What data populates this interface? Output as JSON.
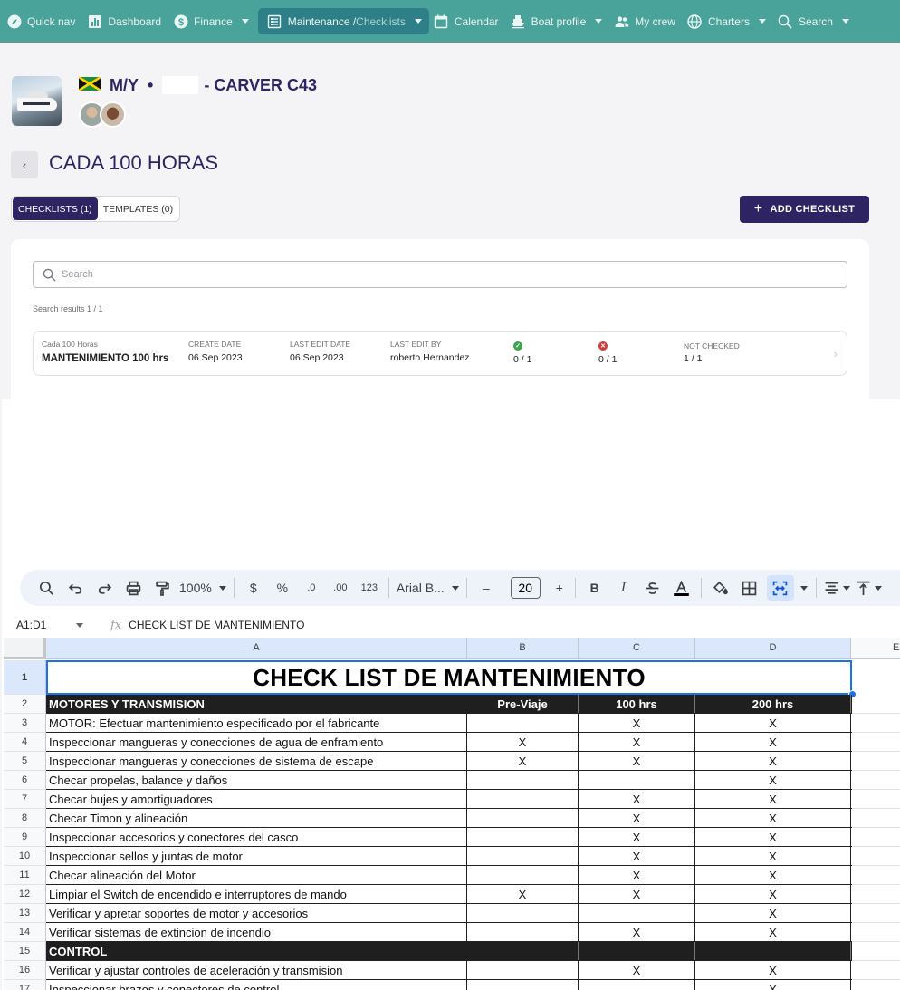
{
  "nav": {
    "items": [
      {
        "label": "Quick nav",
        "icon": "compass-icon"
      },
      {
        "label": "Dashboard",
        "icon": "bar-chart-icon"
      },
      {
        "label": "Finance",
        "icon": "dollar-icon"
      },
      {
        "label": "Maintenance / ",
        "label_dim": "Checklists",
        "icon": "checklist-icon"
      },
      {
        "label": "Calendar",
        "icon": "calendar-icon"
      },
      {
        "label": "Boat profile",
        "icon": "boat-icon"
      },
      {
        "label": "My crew",
        "icon": "people-icon"
      },
      {
        "label": "Charters",
        "icon": "globe-icon"
      },
      {
        "label": "Search",
        "icon": "search-icon"
      }
    ]
  },
  "boat": {
    "prefix": "M/Y",
    "separator": "•",
    "model": "- CARVER C43"
  },
  "page": {
    "back": "‹",
    "title": "CADA 100 HORAS"
  },
  "tabs": [
    {
      "label": "CHECKLISTS (1)",
      "active": true
    },
    {
      "label": "TEMPLATES (0)",
      "active": false
    }
  ],
  "add_button": {
    "icon": "+",
    "label": "ADD CHECKLIST"
  },
  "search": {
    "placeholder": "Search",
    "results": "Search results 1 / 1"
  },
  "checklist_card": {
    "category": "Cada 100 Horas",
    "name": "MANTENIMIENTO 100 hrs",
    "create_label": "CREATE DATE",
    "create_date": "06 Sep 2023",
    "edit_label": "LAST EDIT DATE",
    "edit_date": "06 Sep 2023",
    "editor_label": "LAST EDIT BY",
    "editor": "roberto Hernandez",
    "ok_count": "0 / 1",
    "fail_count": "0 / 1",
    "not_checked_label": "NOT CHECKED",
    "not_checked": "1 / 1"
  },
  "sheet": {
    "zoom": "100%",
    "currency": "$",
    "percent": "%",
    "dec_less": ".0",
    "dec_more": ".00",
    "number_format": "123",
    "font": "Arial B...",
    "font_size": "20",
    "minus": "–",
    "plus": "+",
    "bold": "B",
    "italic": "I",
    "name_box": "A1:D1",
    "fx": "fx",
    "formula": "CHECK LIST DE MANTENIMIENTO",
    "columns": [
      "A",
      "B",
      "C",
      "D",
      "E"
    ],
    "title": "CHECK LIST DE MANTENIMIENTO",
    "rows": [
      {
        "n": "2",
        "a": "MOTORES Y TRANSMISION",
        "b": "Pre-Viaje",
        "c": "100 hrs",
        "d": "200 hrs",
        "dark": true
      },
      {
        "n": "3",
        "a": "MOTOR: Efectuar mantenimiento especificado por el fabricante",
        "b": "",
        "c": "X",
        "d": "X"
      },
      {
        "n": "4",
        "a": "Inspeccionar mangueras y conecciones de agua de enframiento",
        "b": "X",
        "c": "X",
        "d": "X"
      },
      {
        "n": "5",
        "a": "Inspeccionar mangueras y conecciones de sistema de escape",
        "b": "X",
        "c": "X",
        "d": "X"
      },
      {
        "n": "6",
        "a": "Checar propelas, balance y daños",
        "b": "",
        "c": "",
        "d": "X"
      },
      {
        "n": "7",
        "a": "Checar bujes y amortiguadores",
        "b": "",
        "c": "X",
        "d": "X"
      },
      {
        "n": "8",
        "a": "Checar Timon y alineación",
        "b": "",
        "c": "X",
        "d": "X"
      },
      {
        "n": "9",
        "a": "Inspeccionar accesorios y conectores del casco",
        "b": "",
        "c": "X",
        "d": "X"
      },
      {
        "n": "10",
        "a": "Inspeccionar sellos y juntas de motor",
        "b": "",
        "c": "X",
        "d": "X"
      },
      {
        "n": "11",
        "a": "Checar alineación del Motor",
        "b": "",
        "c": "X",
        "d": "X"
      },
      {
        "n": "12",
        "a": "Limpiar el Switch de encendido e interruptores de mando",
        "b": "X",
        "c": "X",
        "d": "X"
      },
      {
        "n": "13",
        "a": "Verificar y apretar soportes de motor y accesorios",
        "b": "",
        "c": "",
        "d": "X"
      },
      {
        "n": "14",
        "a": "Verificar sistemas de extincion de incendio",
        "b": "",
        "c": "X",
        "d": "X"
      },
      {
        "n": "15",
        "a": "CONTROL",
        "b": "",
        "c": "",
        "d": "",
        "dark": true
      },
      {
        "n": "16",
        "a": "Verificar y ajustar controles de aceleración y transmision",
        "b": "",
        "c": "X",
        "d": "X"
      },
      {
        "n": "17",
        "a": "Inspeccionar brazos y conectores de control",
        "b": "",
        "c": "",
        "d": "X"
      }
    ]
  }
}
